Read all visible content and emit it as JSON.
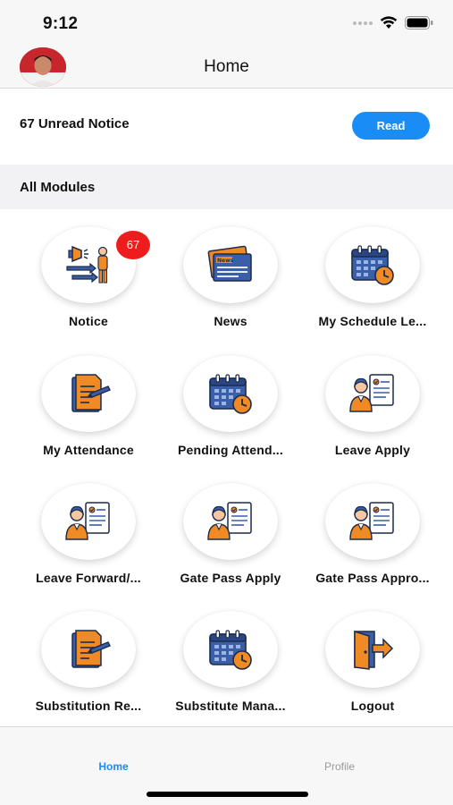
{
  "status_bar": {
    "time": "9:12"
  },
  "nav": {
    "title": "Home"
  },
  "notice": {
    "text": "67 Unread Notice",
    "read_label": "Read"
  },
  "section": {
    "title": "All Modules"
  },
  "modules": [
    {
      "label": "Notice",
      "icon": "megaphone-icon",
      "badge": "67"
    },
    {
      "label": "News",
      "icon": "newspaper-icon"
    },
    {
      "label": "My Schedule Le...",
      "icon": "calendar-clock-icon"
    },
    {
      "label": "My Attendance",
      "icon": "document-pen-icon"
    },
    {
      "label": "Pending Attend...",
      "icon": "calendar-clock-icon"
    },
    {
      "label": "Leave Apply",
      "icon": "person-checklist-icon"
    },
    {
      "label": "Leave Forward/...",
      "icon": "person-checklist-icon"
    },
    {
      "label": "Gate Pass Apply",
      "icon": "person-checklist-icon"
    },
    {
      "label": "Gate Pass Appro...",
      "icon": "person-checklist-icon"
    },
    {
      "label": "Substitution Re...",
      "icon": "document-pen-icon"
    },
    {
      "label": "Substitute Mana...",
      "icon": "calendar-clock-icon"
    },
    {
      "label": "Logout",
      "icon": "logout-door-icon"
    }
  ],
  "tabs": {
    "home": "Home",
    "profile": "Profile"
  },
  "colors": {
    "accent": "#1a8cf5",
    "badge": "#ee1c1c",
    "icon_orange": "#f08a24",
    "icon_blue": "#3b5ea8"
  }
}
